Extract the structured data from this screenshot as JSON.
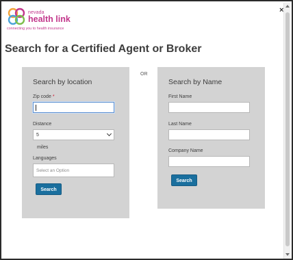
{
  "brand": {
    "small": "nevada",
    "name": "health link",
    "tagline": "connecting you to health insurance",
    "color": "#c2368b"
  },
  "close_icon": "×",
  "page_title": "Search for a Certified Agent or Broker",
  "separator": "OR",
  "location_search": {
    "heading": "Search by location",
    "zip_label": "Zip code",
    "zip_required_marker": "*",
    "zip_value": "",
    "distance_label": "Distance",
    "distance_value": "5",
    "distance_unit": "miles",
    "languages_label": "Languages",
    "languages_placeholder": "Select an Option",
    "search_button": "Search"
  },
  "name_search": {
    "heading": "Search by Name",
    "first_name_label": "First Name",
    "first_name_value": "",
    "last_name_label": "Last Name",
    "last_name_value": "",
    "company_label": "Company Name",
    "company_value": "",
    "search_button": "Search"
  },
  "colors": {
    "panel_bg": "#d3d3d3",
    "button_bg": "#1a6f9e",
    "title": "#3d3d3d",
    "required": "#d0112b"
  }
}
